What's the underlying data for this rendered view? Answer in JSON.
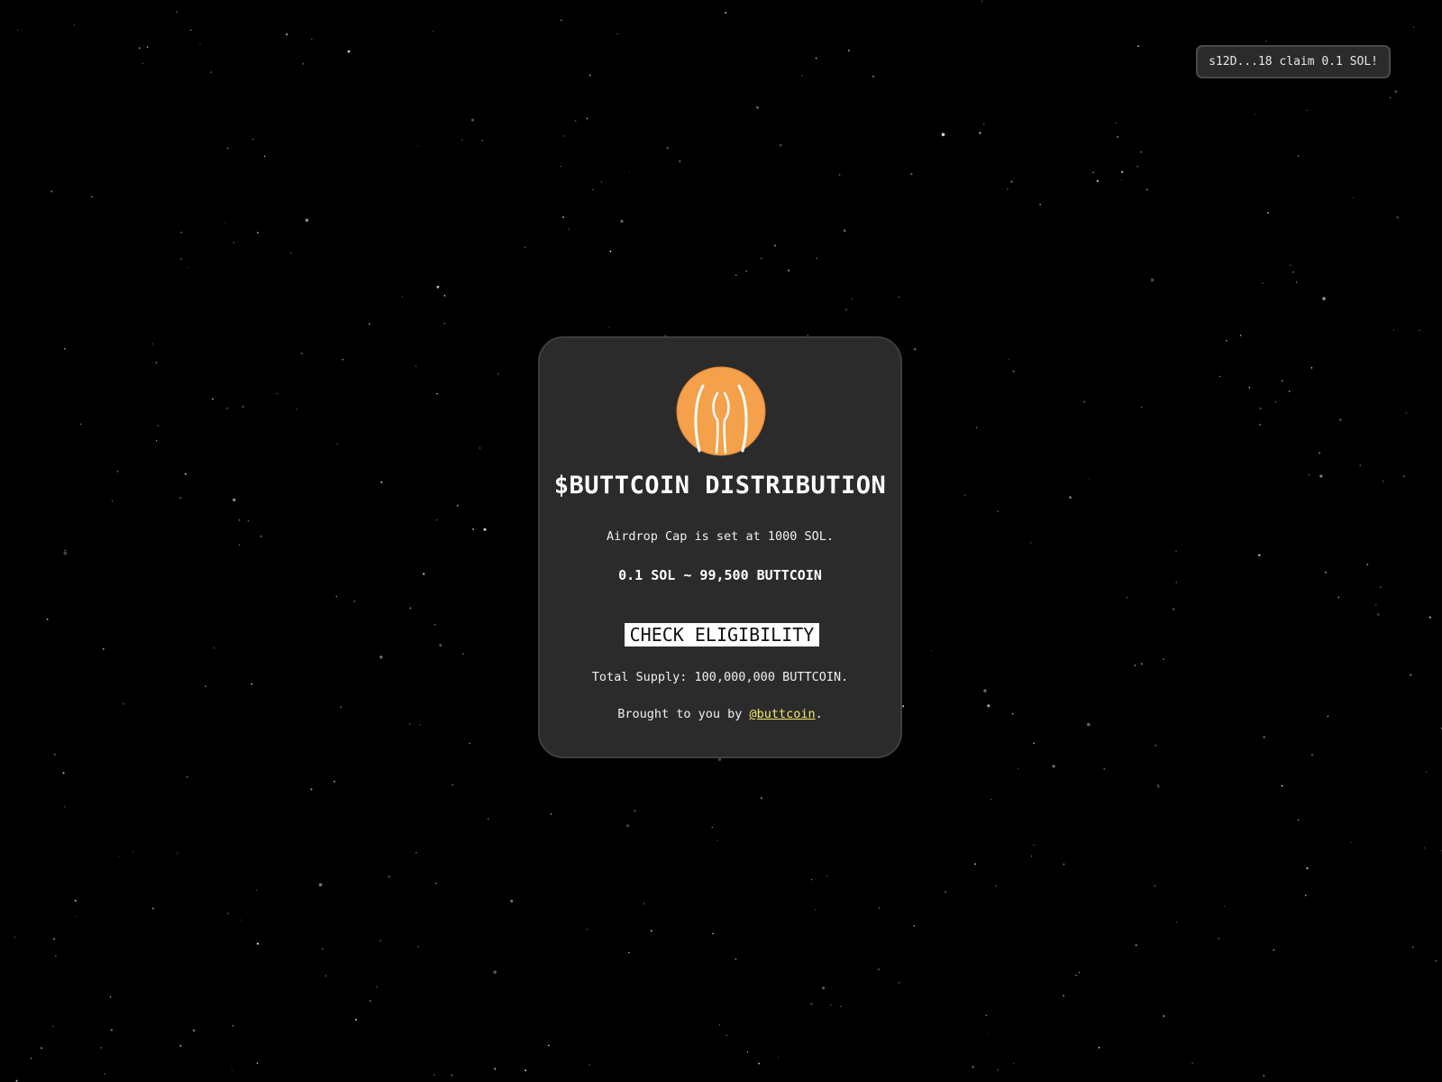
{
  "toast": {
    "text": "s12D...18 claim 0.1 SOL!"
  },
  "card": {
    "logo_icon": "buttcoin-logo-icon",
    "title": "$BUTTCOIN DISTRIBUTION",
    "cap_text": "Airdrop Cap is set at 1000 SOL.",
    "rate_text": "0.1 SOL ~ 99,500 BUTTCOIN",
    "check_button_label": "CHECK ELIGIBILITY",
    "supply_text": "Total Supply: 100,000,000 BUTTCOIN.",
    "credit_prefix": "Brought to you by ",
    "credit_link": "@buttcoin",
    "credit_suffix": "."
  },
  "colors": {
    "background": "#000000",
    "card": "#2b2b2b",
    "logo": "#f5a04a",
    "link": "#f3e96a"
  }
}
